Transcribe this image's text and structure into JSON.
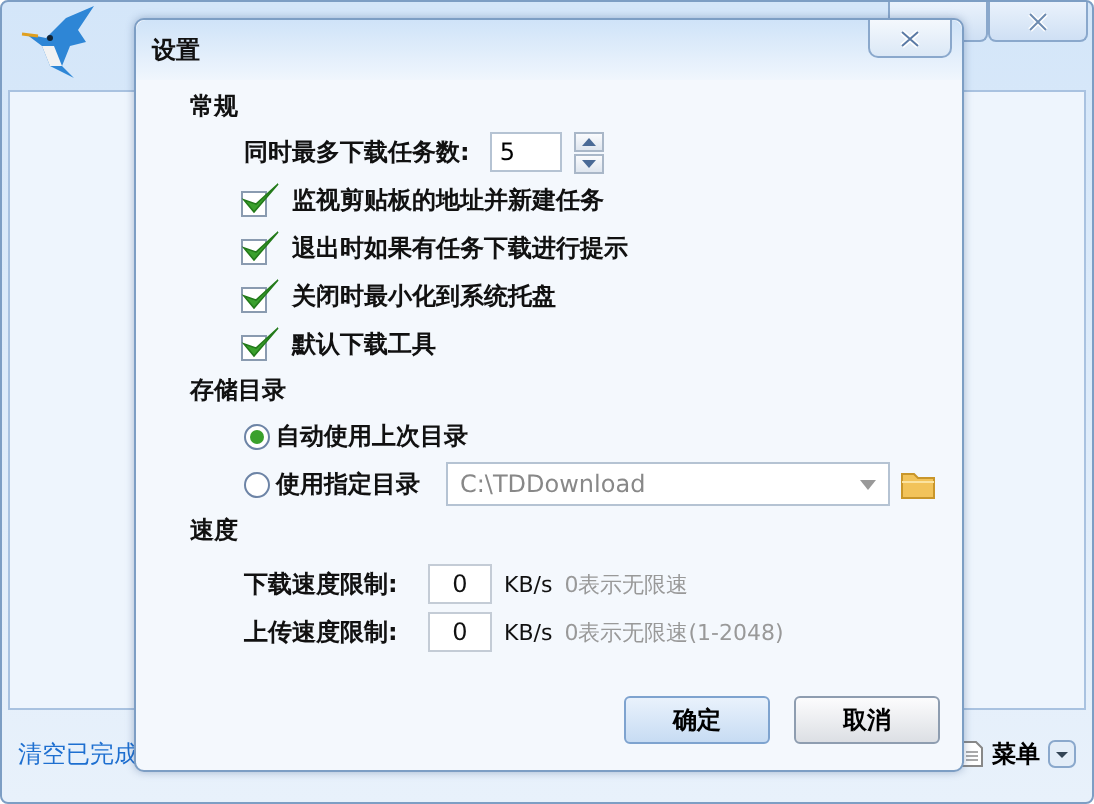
{
  "main_window": {
    "footer": {
      "clear_link": "清空已完成",
      "menu_label": "菜单"
    }
  },
  "dialog": {
    "title": "设置",
    "general": {
      "heading": "常规",
      "max_tasks": {
        "label": "同时最多下载任务数:",
        "value": "5"
      },
      "options": [
        {
          "label": "监视剪贴板的地址并新建任务",
          "checked": true
        },
        {
          "label": "退出时如果有任务下载进行提示",
          "checked": true
        },
        {
          "label": "关闭时最小化到系统托盘",
          "checked": true
        },
        {
          "label": "默认下载工具",
          "checked": true
        }
      ]
    },
    "storage": {
      "heading": "存储目录",
      "choices": [
        {
          "label": "自动使用上次目录",
          "selected": true
        },
        {
          "label": "使用指定目录",
          "selected": false
        }
      ],
      "path": {
        "value": "C:\\TDDownload",
        "disabled": true
      }
    },
    "speed": {
      "heading": "速度",
      "limits": [
        {
          "label": "下载速度限制:",
          "value": "0",
          "unit": "KB/s",
          "hint": "0表示无限速"
        },
        {
          "label": "上传速度限制:",
          "value": "0",
          "unit": "KB/s",
          "hint": "0表示无限速(1-2048)"
        }
      ]
    },
    "buttons": [
      {
        "label": "确定",
        "default": true
      },
      {
        "label": "取消",
        "default": false
      }
    ]
  }
}
